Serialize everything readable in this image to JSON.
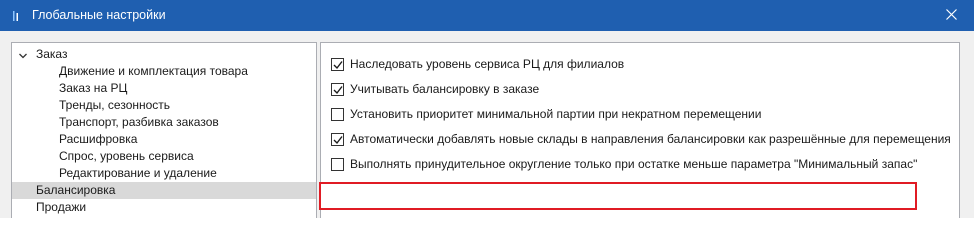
{
  "window": {
    "title": "Глобальные настройки",
    "title_bar_color": "#1f5fb0",
    "highlight_color": "#e01b24"
  },
  "tree": {
    "root_label": "Заказ",
    "root_children": [
      "Движение и комплектация товара",
      "Заказ на РЦ",
      "Тренды, сезонность",
      "Транспорт, разбивка заказов",
      "Расшифровка",
      "Спрос, уровень сервиса",
      "Редактирование и удаление"
    ],
    "selected_label": "Балансировка",
    "last_label": "Продажи"
  },
  "options": [
    {
      "label": "Наследовать уровень сервиса РЦ для филиалов",
      "checked": true
    },
    {
      "label": "Учитывать балансировку в заказе",
      "checked": true
    },
    {
      "label": "Установить приоритет минимальной партии при некратном перемещении",
      "checked": false
    },
    {
      "label": "Автоматически добавлять новые склады в направления балансировки как разрешённые для перемещения",
      "checked": true
    },
    {
      "label": "Выполнять принудительное округление только при остатке меньше параметра \"Минимальный запас\"",
      "checked": false
    }
  ]
}
